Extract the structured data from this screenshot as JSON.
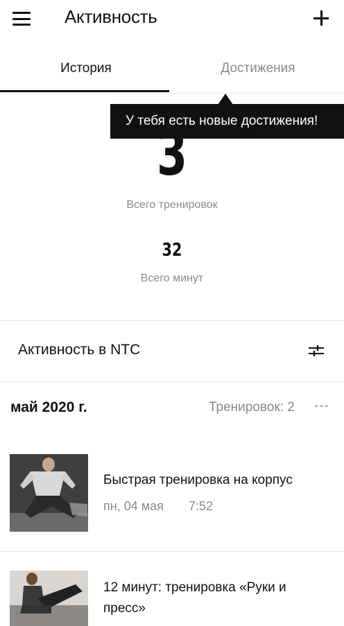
{
  "header": {
    "title": "Активность",
    "menu_icon": "hamburger-menu-icon",
    "add_icon": "plus-icon"
  },
  "tabs": [
    {
      "label": "История",
      "active": true
    },
    {
      "label": "Достижения",
      "active": false
    }
  ],
  "tooltip": {
    "text": "У тебя есть новые достижения!"
  },
  "stats": {
    "total_workouts": {
      "value": "3",
      "label": "Всего тренировок"
    },
    "total_minutes": {
      "value": "32",
      "label": "Всего минут"
    }
  },
  "section": {
    "title": "Активность в NTC",
    "filter_icon": "filter-sliders-icon"
  },
  "month": {
    "label": "май 2020 г.",
    "count": "Тренировок: 2",
    "more": "---"
  },
  "workouts": [
    {
      "title": "Быстрая тренировка на корпус",
      "date": "пн, 04 мая",
      "time": "7:52"
    },
    {
      "title": "12 минут: тренировка «Руки и пресс»"
    }
  ],
  "colors": {
    "text": "#111111",
    "muted": "#8a8a8a",
    "tooltip_bg": "#111111",
    "divider": "#e3e3e3"
  }
}
